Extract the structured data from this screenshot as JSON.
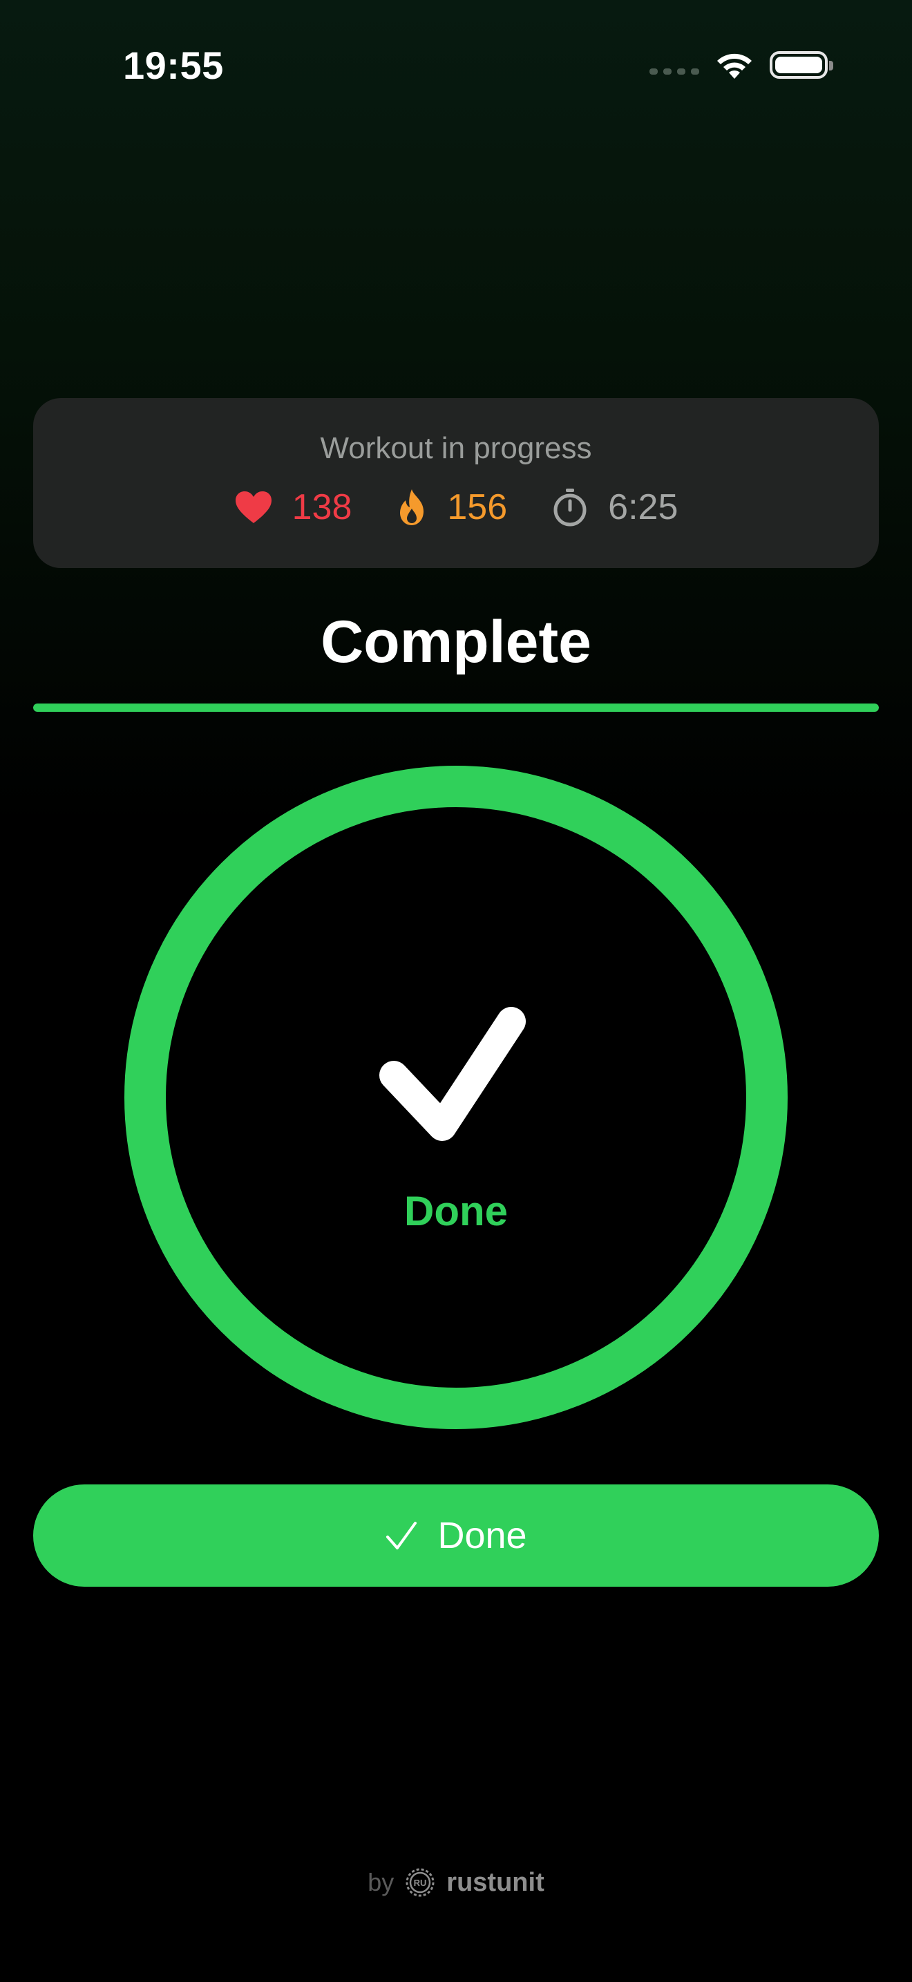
{
  "status_bar": {
    "time": "19:55"
  },
  "workout": {
    "title": "Workout in progress",
    "heart_rate": "138",
    "calories": "156",
    "elapsed": "6:25"
  },
  "page": {
    "title": "Complete",
    "progress_fraction": 1.0
  },
  "ring": {
    "label": "Done"
  },
  "actions": {
    "done_label": "Done"
  },
  "footer": {
    "by": "by",
    "brand": "rustunit"
  },
  "colors": {
    "accent_green": "#30d05a",
    "heart_red": "#ef3b46",
    "calories_orange": "#f59a2c",
    "card_bg": "#222423"
  },
  "icons": [
    "wifi-icon",
    "battery-icon",
    "heart-icon",
    "flame-icon",
    "stopwatch-icon",
    "checkmark-icon",
    "rustunit-logo-icon"
  ]
}
